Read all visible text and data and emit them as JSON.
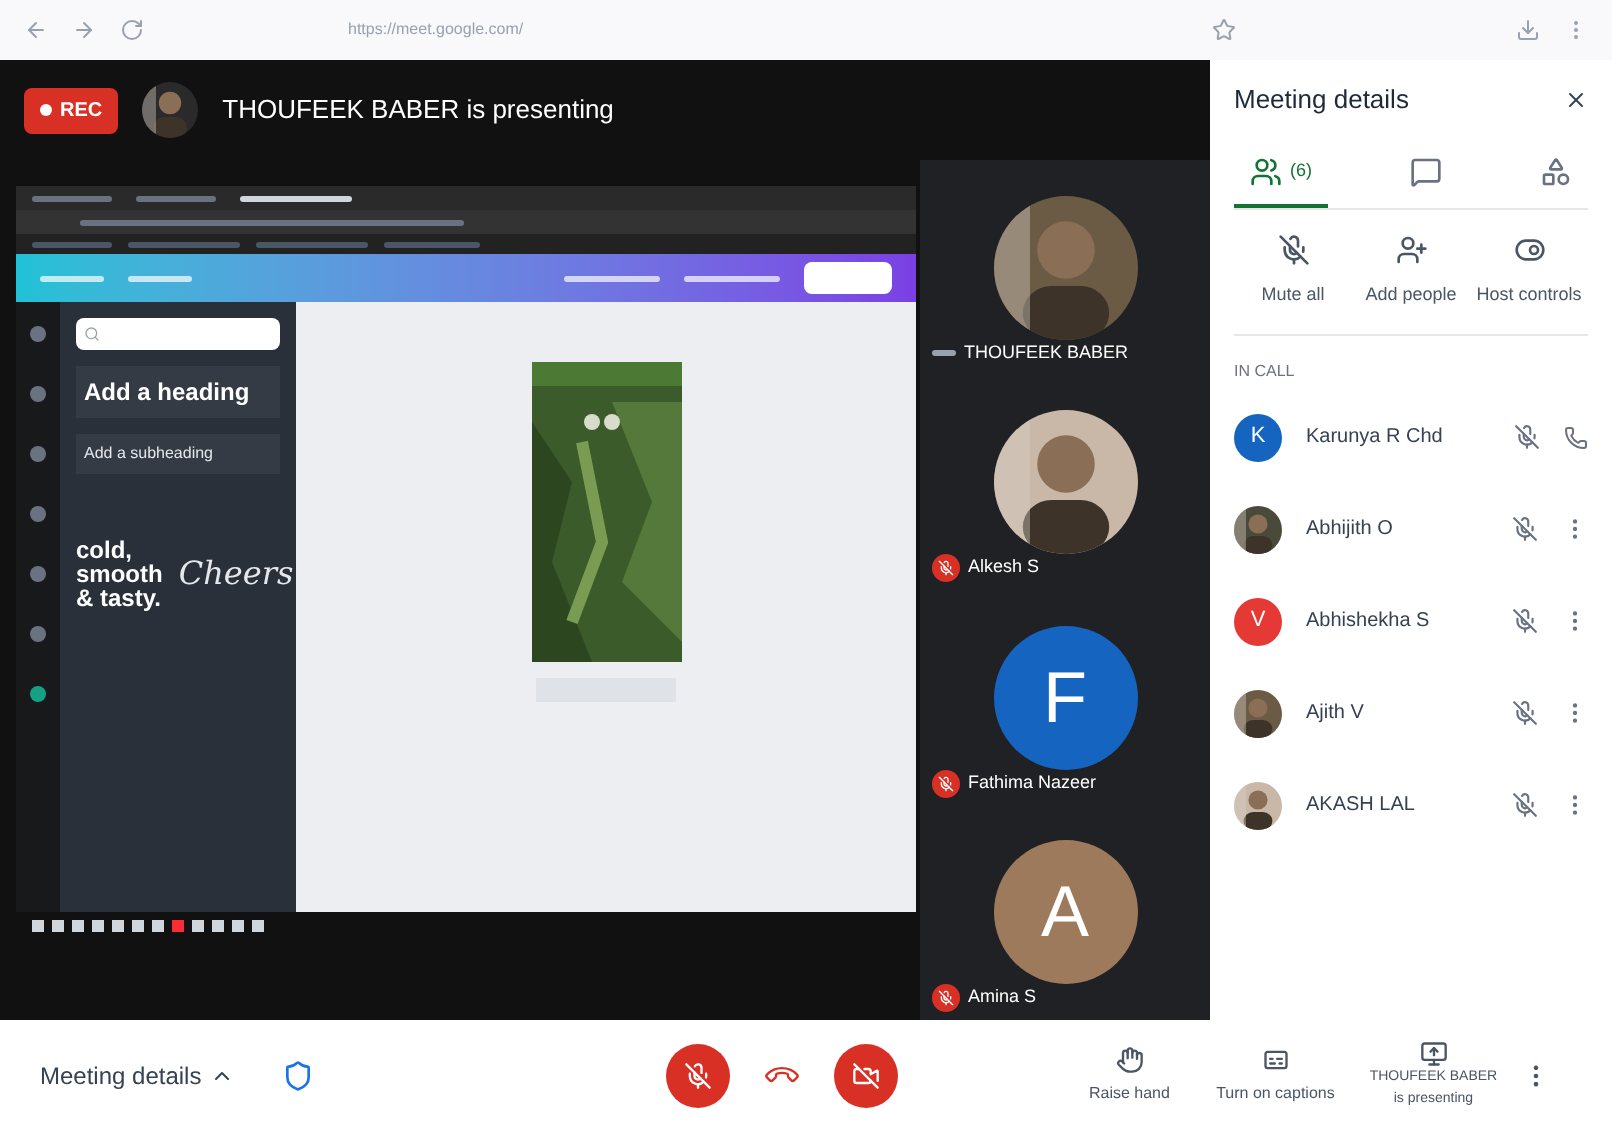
{
  "browser": {
    "url": "https://meet.google.com/"
  },
  "header": {
    "rec": "REC",
    "presenter_text": "THOUFEEK BABER is presenting"
  },
  "shared_screen": {
    "heading": "Add a heading",
    "subheading": "Add a subheading",
    "sample_1": "cold, smooth & tasty.",
    "sample_2": "Cheers"
  },
  "tiles": [
    {
      "name": "THOUFEEK BABER",
      "muted": false
    },
    {
      "name": "Alkesh S",
      "muted": true
    },
    {
      "name": "Fathima Nazeer",
      "kind": "letter",
      "letter": "F",
      "color": "#1565c0",
      "muted": true
    },
    {
      "name": "Amina S",
      "kind": "letter",
      "letter": "A",
      "color": "#9c7a5b",
      "muted": true
    }
  ],
  "panel": {
    "title": "Meeting details",
    "tabs": [
      {
        "kind": "people",
        "label": "(6)",
        "selected": true
      },
      {
        "kind": "chat",
        "selected": false
      },
      {
        "kind": "activities",
        "selected": false
      }
    ],
    "actions": [
      {
        "kind": "mute",
        "label": "Mute all"
      },
      {
        "kind": "add",
        "label": "Add people"
      },
      {
        "kind": "host",
        "label": "Host controls"
      }
    ],
    "section": "IN CALL",
    "people": [
      {
        "name": "Karunya R Chd",
        "kind": "letter",
        "letter": "K",
        "color": "#1565c0",
        "trailing": {
          "kind": "phone"
        }
      },
      {
        "name": "Abhijith O",
        "trailing": {
          "kind": "more"
        }
      },
      {
        "name": "Abhishekha S",
        "kind": "letter",
        "letter": "V",
        "color": "#e53935",
        "trailing": {
          "kind": "more"
        }
      },
      {
        "name": "Ajith V",
        "trailing": {
          "kind": "more"
        }
      },
      {
        "name": "AKASH LAL",
        "trailing": {
          "kind": "more"
        }
      }
    ]
  },
  "bottom_bar": {
    "details": "Meeting details",
    "raise_hand": "Raise hand",
    "captions": "Turn on captions",
    "presenting_1": "THOUFEEK BABER",
    "presenting_2": "is presenting"
  }
}
